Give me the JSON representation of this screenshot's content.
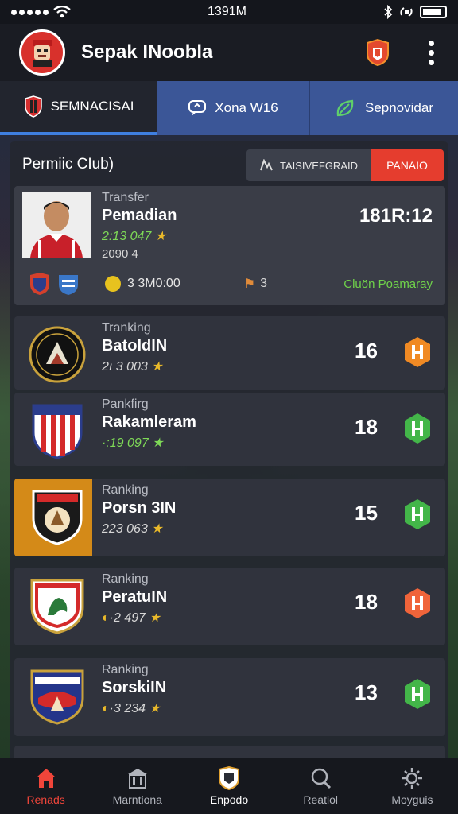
{
  "status_bar": {
    "time": "1391M"
  },
  "app": {
    "title": "Sepak INoobla"
  },
  "tabs": [
    {
      "label": "SEMNACISAI",
      "icon": "shield-icon"
    },
    {
      "label": "Xona W16",
      "icon": "chat-icon"
    },
    {
      "label": "Sepnovidar",
      "icon": "leaf-icon"
    }
  ],
  "panel": {
    "title": "Permiic CIub)",
    "filter_label": "TAISIVEFGRAID",
    "filter_action": "PANAIO"
  },
  "featured": {
    "label": "Transfer",
    "name": "Pemadian",
    "stats": "2:13 047",
    "sub": "2090 4",
    "score": "181R:12",
    "time": "3 3M0:00",
    "flags": "3",
    "promo": "Cluön Poamaray"
  },
  "rankings": [
    {
      "label": "Tranking",
      "name": "BatoldIN",
      "stats": "2ı 3 003",
      "stats_color": "white",
      "rank": "16",
      "badge_color": "#f08a24"
    },
    {
      "label": "Pankfirg",
      "name": "Rakamleram",
      "stats": "·:19 097",
      "stats_color": "green",
      "rank": "18",
      "badge_color": "#43b649"
    },
    {
      "label": "Ranking",
      "name": "Porsn 3IN",
      "stats": "223 063",
      "stats_color": "white",
      "rank": "15",
      "badge_color": "#43b649"
    },
    {
      "label": "Ranking",
      "name": "PeratuIN",
      "stats": "·2 497",
      "stats_color": "white",
      "rank": "18",
      "badge_color": "#f0643a"
    },
    {
      "label": "Ranking",
      "name": "SorskiIN",
      "stats": "·3 234",
      "stats_color": "white",
      "rank": "13",
      "badge_color": "#43b649"
    }
  ],
  "nav": [
    {
      "label": "Renads",
      "icon": "home-icon",
      "active": true
    },
    {
      "label": "Marntiona",
      "icon": "building-icon",
      "active": false
    },
    {
      "label": "Enpodo",
      "icon": "shield-crest-icon",
      "active": false
    },
    {
      "label": "Reatiol",
      "icon": "search-icon",
      "active": false
    },
    {
      "label": "Moyguis",
      "icon": "settings-icon",
      "active": false
    }
  ],
  "colors": {
    "accent_red": "#e53d2e",
    "accent_blue": "#3b5697",
    "accent_green": "#7ed957"
  }
}
